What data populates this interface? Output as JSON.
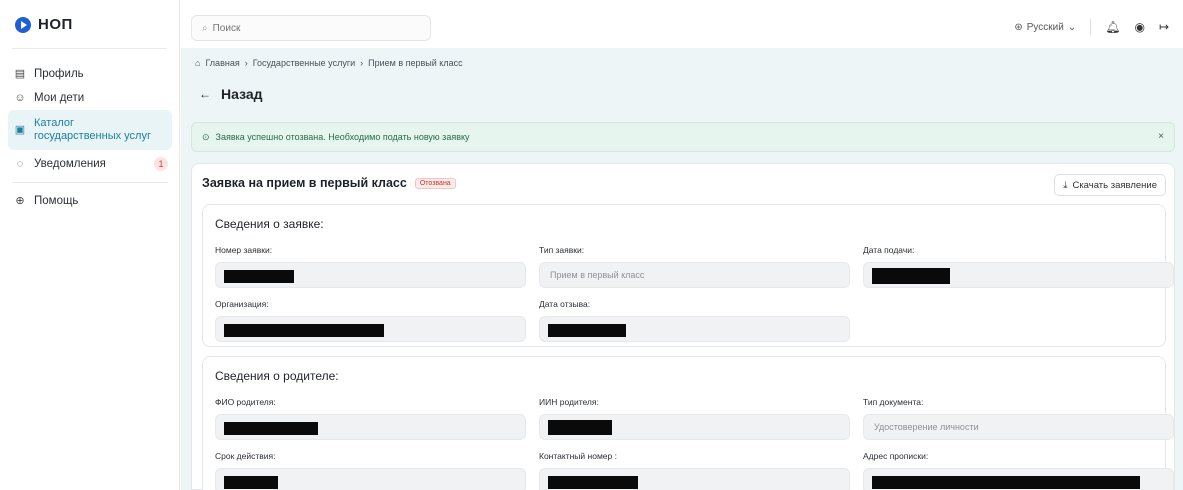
{
  "app": {
    "logo_text": "НОП"
  },
  "sidebar": {
    "items": [
      {
        "label": "Профиль",
        "icon": "profile-card-icon"
      },
      {
        "label": "Мои дети",
        "icon": "children-icon"
      },
      {
        "label": "Каталог государственных услуг",
        "icon": "catalog-icon",
        "active": true
      },
      {
        "label": "Уведомления",
        "icon": "notifications-icon",
        "badge": "1"
      },
      {
        "label": "Помощь",
        "icon": "help-icon"
      }
    ]
  },
  "topbar": {
    "search_placeholder": "Поиск",
    "language": "Русский"
  },
  "breadcrumb": [
    "Главная",
    "Государственные услуги",
    "Прием в первый класс"
  ],
  "back_label": "Назад",
  "alert": {
    "text": "Заявка успешно отозвана. Необходимо подать новую заявку",
    "close": "×"
  },
  "application": {
    "title": "Заявка на прием в первый класс",
    "status": "Отозвана",
    "download_label": "Скачать заявление"
  },
  "sections": {
    "application_info": {
      "title": "Сведения о заявке:",
      "fields": [
        {
          "label": "Номер заявки:",
          "value": ""
        },
        {
          "label": "Тип заявки:",
          "value": "Прием в первый класс"
        },
        {
          "label": "Дата подачи:",
          "value": ""
        },
        {
          "label": "Организация:",
          "value": ""
        },
        {
          "label": "Дата отзыва:",
          "value": ""
        }
      ]
    },
    "parent_info": {
      "title": "Сведения о родителе:",
      "fields": [
        {
          "label": "ФИО родителя:",
          "value": ""
        },
        {
          "label": "ИИН родителя:",
          "value": ""
        },
        {
          "label": "Тип документа:",
          "value": "Удостоверение личности"
        },
        {
          "label": "Срок действия:",
          "value": ""
        },
        {
          "label": "Контактный номер :",
          "value": ""
        },
        {
          "label": "Адрес прописки:",
          "value": ""
        }
      ]
    }
  },
  "colors": {
    "accent": "#1f5fd6",
    "active_bg": "#e9f4f6",
    "alert_bg": "#e6f6ee",
    "status_red": "#c0392b"
  }
}
